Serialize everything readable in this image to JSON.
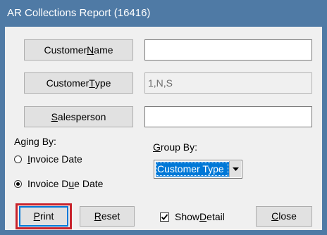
{
  "window": {
    "title": "AR Collections Report (16416)"
  },
  "filters": {
    "customer_name": {
      "label_pre": "Customer ",
      "label_key": "N",
      "label_post": "ame",
      "value": ""
    },
    "customer_type": {
      "label_pre": "Customer ",
      "label_key": "T",
      "label_post": "ype",
      "value": "1,N,S"
    },
    "salesperson": {
      "label_pre": "",
      "label_key": "S",
      "label_post": "alesperson",
      "value": ""
    }
  },
  "aging": {
    "label": "Aging By:",
    "options": [
      {
        "pre": "",
        "key": "I",
        "post": "nvoice Date",
        "selected": false
      },
      {
        "pre": "Invoice D",
        "key": "u",
        "post": "e Date",
        "selected": true
      }
    ]
  },
  "group_by": {
    "label_pre": "",
    "label_key": "G",
    "label_post": "roup By:",
    "selected": "Customer Type"
  },
  "actions": {
    "print": {
      "pre": "",
      "key": "P",
      "post": "rint"
    },
    "reset": {
      "pre": "",
      "key": "R",
      "post": "eset"
    },
    "show_detail": {
      "pre": "Show ",
      "key": "D",
      "post": "etail",
      "checked": true
    },
    "close": {
      "pre": "",
      "key": "C",
      "post": "lose"
    }
  },
  "colors": {
    "titlebar": "#4f7aa5",
    "highlight": "#c8232c",
    "selection": "#0078d7"
  }
}
